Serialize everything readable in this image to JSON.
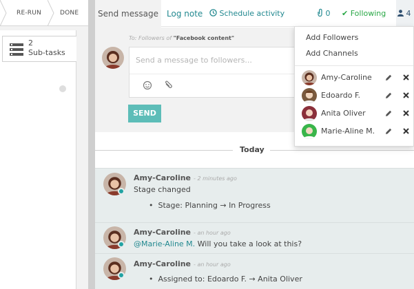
{
  "statusbar": {
    "stage_rerun": "RE-RUN",
    "stage_done": "DONE"
  },
  "form": {
    "subtasks_count": "2",
    "subtasks_label": "Sub-tasks",
    "subtasks_icon": "list-icon"
  },
  "chatter": {
    "tab_send_message": "Send message",
    "tab_log_note": "Log note",
    "schedule_activity": "Schedule activity",
    "attachments_count": "0",
    "following_label": "Following",
    "followers_count": "4",
    "colors": {
      "accent": "#21888f",
      "following": "#28a745",
      "send_button": "#5dbdb8",
      "message_bg": "#e7eded"
    }
  },
  "composer": {
    "to_prefix": "To: Followers of",
    "to_record": "\"Facebook content\"",
    "placeholder": "Send a message to followers...",
    "send_label": "SEND"
  },
  "thread": {
    "day_separator": "Today",
    "messages": [
      {
        "author": "Amy-Caroline",
        "time": "- 2 minutes ago",
        "text": "Stage changed",
        "tracking": "Stage: Planning → In Progress"
      },
      {
        "author": "Amy-Caroline",
        "time": "- an hour ago",
        "mention": "@Marie-Aline M.",
        "text": " Will you take a look at this?"
      },
      {
        "author": "Amy-Caroline",
        "time": "- an hour ago",
        "tracking": "Assigned to: Edoardo F. → Anita Oliver"
      }
    ]
  },
  "followers_menu": {
    "add_followers": "Add Followers",
    "add_channels": "Add Channels",
    "followers": [
      {
        "name": "Amy-Caroline"
      },
      {
        "name": "Edoardo F."
      },
      {
        "name": "Anita Oliver"
      },
      {
        "name": "Marie-Aline M."
      }
    ]
  }
}
